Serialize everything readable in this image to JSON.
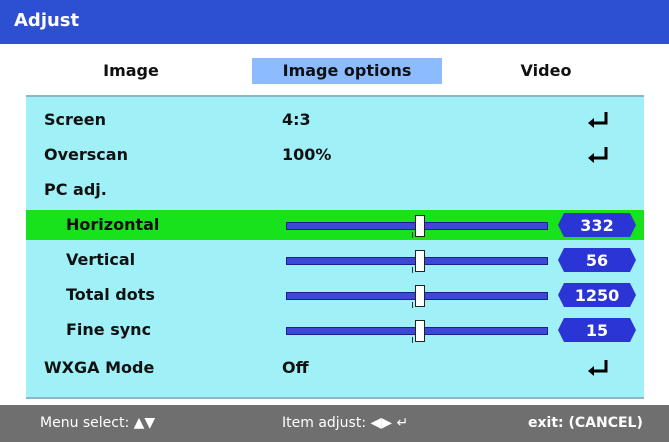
{
  "window": {
    "title": "Adjust"
  },
  "tabs": [
    {
      "label": "Image"
    },
    {
      "label": "Image options"
    },
    {
      "label": "Video"
    }
  ],
  "rows": {
    "screen": {
      "label": "Screen",
      "value": "4:3"
    },
    "overscan": {
      "label": "Overscan",
      "value": "100%"
    },
    "pc_adj": {
      "label": "PC adj."
    },
    "horizontal": {
      "label": "Horizontal",
      "value": "332",
      "slider_position": 0.51
    },
    "vertical": {
      "label": "Vertical",
      "value": "56",
      "slider_position": 0.51
    },
    "total_dots": {
      "label": "Total dots",
      "value": "1250",
      "slider_position": 0.51
    },
    "fine_sync": {
      "label": "Fine sync",
      "value": "15",
      "slider_position": 0.51
    },
    "wxga": {
      "label": "WXGA Mode",
      "value": "Off"
    }
  },
  "status": {
    "menu_select": "Menu select: ▲▼",
    "item_adjust": "Item adjust: ◀▶ ↵",
    "exit": "exit: (CANCEL)"
  },
  "colors": {
    "title_bar": "#2d4fd1",
    "panel": "#9ff0f7",
    "selected_row": "#17e21b",
    "active_tab": "#8cbcff",
    "badge": "#2b35d6",
    "status_bar": "#6f6f6f"
  },
  "icons": {
    "enter": "enter-key-icon",
    "arrows_up_down": "up-down-arrows-icon",
    "arrows_left_right": "left-right-arrows-icon"
  }
}
